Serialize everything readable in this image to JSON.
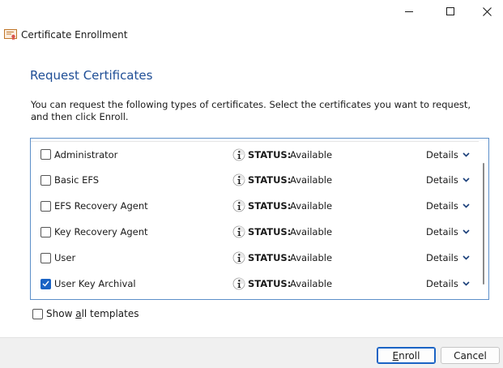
{
  "window": {
    "title": "Certificate Enrollment"
  },
  "page": {
    "heading": "Request Certificates",
    "intro": "You can request the following types of certificates. Select the certificates you want to request, and then click Enroll."
  },
  "certificates": [
    {
      "name": "Administrator",
      "status_label": "STATUS:",
      "status": "Available",
      "details": "Details",
      "checked": false
    },
    {
      "name": "Basic EFS",
      "status_label": "STATUS:",
      "status": "Available",
      "details": "Details",
      "checked": false
    },
    {
      "name": "EFS Recovery Agent",
      "status_label": "STATUS:",
      "status": "Available",
      "details": "Details",
      "checked": false
    },
    {
      "name": "Key Recovery Agent",
      "status_label": "STATUS:",
      "status": "Available",
      "details": "Details",
      "checked": false
    },
    {
      "name": "User",
      "status_label": "STATUS:",
      "status": "Available",
      "details": "Details",
      "checked": false
    },
    {
      "name": "User Key Archival",
      "status_label": "STATUS:",
      "status": "Available",
      "details": "Details",
      "checked": true
    }
  ],
  "show_all": {
    "label_pre": "Show ",
    "label_accel": "a",
    "label_post": "ll templates",
    "checked": false
  },
  "buttons": {
    "enroll_accel": "E",
    "enroll_rest": "nroll",
    "cancel": "Cancel"
  },
  "colors": {
    "heading": "#1f4e96",
    "accent": "#1a63c4",
    "listbox_border": "#5c8fc9"
  },
  "icons": {
    "window_icon": "certificate-icon",
    "status_icon": "info-icon",
    "details_icon": "chevron-down-icon"
  }
}
